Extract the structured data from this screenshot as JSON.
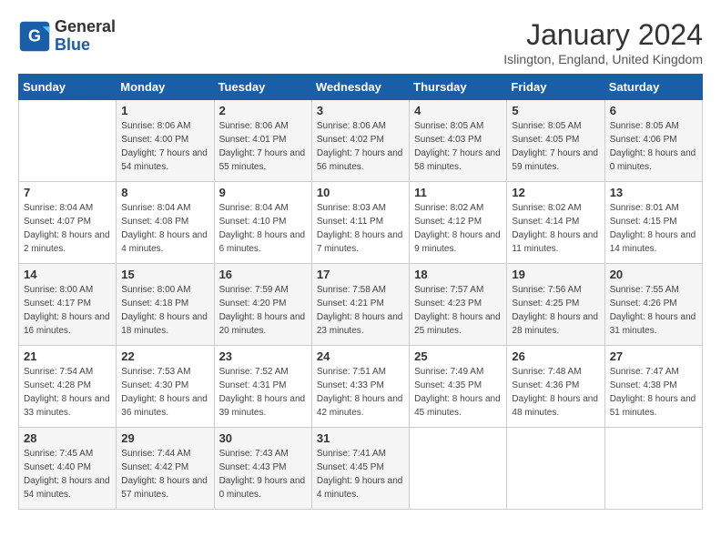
{
  "header": {
    "logo_general": "General",
    "logo_blue": "Blue",
    "month": "January 2024",
    "location": "Islington, England, United Kingdom"
  },
  "weekdays": [
    "Sunday",
    "Monday",
    "Tuesday",
    "Wednesday",
    "Thursday",
    "Friday",
    "Saturday"
  ],
  "weeks": [
    [
      {
        "day": "",
        "sunrise": "",
        "sunset": "",
        "daylight": ""
      },
      {
        "day": "1",
        "sunrise": "Sunrise: 8:06 AM",
        "sunset": "Sunset: 4:00 PM",
        "daylight": "Daylight: 7 hours and 54 minutes."
      },
      {
        "day": "2",
        "sunrise": "Sunrise: 8:06 AM",
        "sunset": "Sunset: 4:01 PM",
        "daylight": "Daylight: 7 hours and 55 minutes."
      },
      {
        "day": "3",
        "sunrise": "Sunrise: 8:06 AM",
        "sunset": "Sunset: 4:02 PM",
        "daylight": "Daylight: 7 hours and 56 minutes."
      },
      {
        "day": "4",
        "sunrise": "Sunrise: 8:05 AM",
        "sunset": "Sunset: 4:03 PM",
        "daylight": "Daylight: 7 hours and 58 minutes."
      },
      {
        "day": "5",
        "sunrise": "Sunrise: 8:05 AM",
        "sunset": "Sunset: 4:05 PM",
        "daylight": "Daylight: 7 hours and 59 minutes."
      },
      {
        "day": "6",
        "sunrise": "Sunrise: 8:05 AM",
        "sunset": "Sunset: 4:06 PM",
        "daylight": "Daylight: 8 hours and 0 minutes."
      }
    ],
    [
      {
        "day": "7",
        "sunrise": "Sunrise: 8:04 AM",
        "sunset": "Sunset: 4:07 PM",
        "daylight": "Daylight: 8 hours and 2 minutes."
      },
      {
        "day": "8",
        "sunrise": "Sunrise: 8:04 AM",
        "sunset": "Sunset: 4:08 PM",
        "daylight": "Daylight: 8 hours and 4 minutes."
      },
      {
        "day": "9",
        "sunrise": "Sunrise: 8:04 AM",
        "sunset": "Sunset: 4:10 PM",
        "daylight": "Daylight: 8 hours and 6 minutes."
      },
      {
        "day": "10",
        "sunrise": "Sunrise: 8:03 AM",
        "sunset": "Sunset: 4:11 PM",
        "daylight": "Daylight: 8 hours and 7 minutes."
      },
      {
        "day": "11",
        "sunrise": "Sunrise: 8:02 AM",
        "sunset": "Sunset: 4:12 PM",
        "daylight": "Daylight: 8 hours and 9 minutes."
      },
      {
        "day": "12",
        "sunrise": "Sunrise: 8:02 AM",
        "sunset": "Sunset: 4:14 PM",
        "daylight": "Daylight: 8 hours and 11 minutes."
      },
      {
        "day": "13",
        "sunrise": "Sunrise: 8:01 AM",
        "sunset": "Sunset: 4:15 PM",
        "daylight": "Daylight: 8 hours and 14 minutes."
      }
    ],
    [
      {
        "day": "14",
        "sunrise": "Sunrise: 8:00 AM",
        "sunset": "Sunset: 4:17 PM",
        "daylight": "Daylight: 8 hours and 16 minutes."
      },
      {
        "day": "15",
        "sunrise": "Sunrise: 8:00 AM",
        "sunset": "Sunset: 4:18 PM",
        "daylight": "Daylight: 8 hours and 18 minutes."
      },
      {
        "day": "16",
        "sunrise": "Sunrise: 7:59 AM",
        "sunset": "Sunset: 4:20 PM",
        "daylight": "Daylight: 8 hours and 20 minutes."
      },
      {
        "day": "17",
        "sunrise": "Sunrise: 7:58 AM",
        "sunset": "Sunset: 4:21 PM",
        "daylight": "Daylight: 8 hours and 23 minutes."
      },
      {
        "day": "18",
        "sunrise": "Sunrise: 7:57 AM",
        "sunset": "Sunset: 4:23 PM",
        "daylight": "Daylight: 8 hours and 25 minutes."
      },
      {
        "day": "19",
        "sunrise": "Sunrise: 7:56 AM",
        "sunset": "Sunset: 4:25 PM",
        "daylight": "Daylight: 8 hours and 28 minutes."
      },
      {
        "day": "20",
        "sunrise": "Sunrise: 7:55 AM",
        "sunset": "Sunset: 4:26 PM",
        "daylight": "Daylight: 8 hours and 31 minutes."
      }
    ],
    [
      {
        "day": "21",
        "sunrise": "Sunrise: 7:54 AM",
        "sunset": "Sunset: 4:28 PM",
        "daylight": "Daylight: 8 hours and 33 minutes."
      },
      {
        "day": "22",
        "sunrise": "Sunrise: 7:53 AM",
        "sunset": "Sunset: 4:30 PM",
        "daylight": "Daylight: 8 hours and 36 minutes."
      },
      {
        "day": "23",
        "sunrise": "Sunrise: 7:52 AM",
        "sunset": "Sunset: 4:31 PM",
        "daylight": "Daylight: 8 hours and 39 minutes."
      },
      {
        "day": "24",
        "sunrise": "Sunrise: 7:51 AM",
        "sunset": "Sunset: 4:33 PM",
        "daylight": "Daylight: 8 hours and 42 minutes."
      },
      {
        "day": "25",
        "sunrise": "Sunrise: 7:49 AM",
        "sunset": "Sunset: 4:35 PM",
        "daylight": "Daylight: 8 hours and 45 minutes."
      },
      {
        "day": "26",
        "sunrise": "Sunrise: 7:48 AM",
        "sunset": "Sunset: 4:36 PM",
        "daylight": "Daylight: 8 hours and 48 minutes."
      },
      {
        "day": "27",
        "sunrise": "Sunrise: 7:47 AM",
        "sunset": "Sunset: 4:38 PM",
        "daylight": "Daylight: 8 hours and 51 minutes."
      }
    ],
    [
      {
        "day": "28",
        "sunrise": "Sunrise: 7:45 AM",
        "sunset": "Sunset: 4:40 PM",
        "daylight": "Daylight: 8 hours and 54 minutes."
      },
      {
        "day": "29",
        "sunrise": "Sunrise: 7:44 AM",
        "sunset": "Sunset: 4:42 PM",
        "daylight": "Daylight: 8 hours and 57 minutes."
      },
      {
        "day": "30",
        "sunrise": "Sunrise: 7:43 AM",
        "sunset": "Sunset: 4:43 PM",
        "daylight": "Daylight: 9 hours and 0 minutes."
      },
      {
        "day": "31",
        "sunrise": "Sunrise: 7:41 AM",
        "sunset": "Sunset: 4:45 PM",
        "daylight": "Daylight: 9 hours and 4 minutes."
      },
      {
        "day": "",
        "sunrise": "",
        "sunset": "",
        "daylight": ""
      },
      {
        "day": "",
        "sunrise": "",
        "sunset": "",
        "daylight": ""
      },
      {
        "day": "",
        "sunrise": "",
        "sunset": "",
        "daylight": ""
      }
    ]
  ]
}
